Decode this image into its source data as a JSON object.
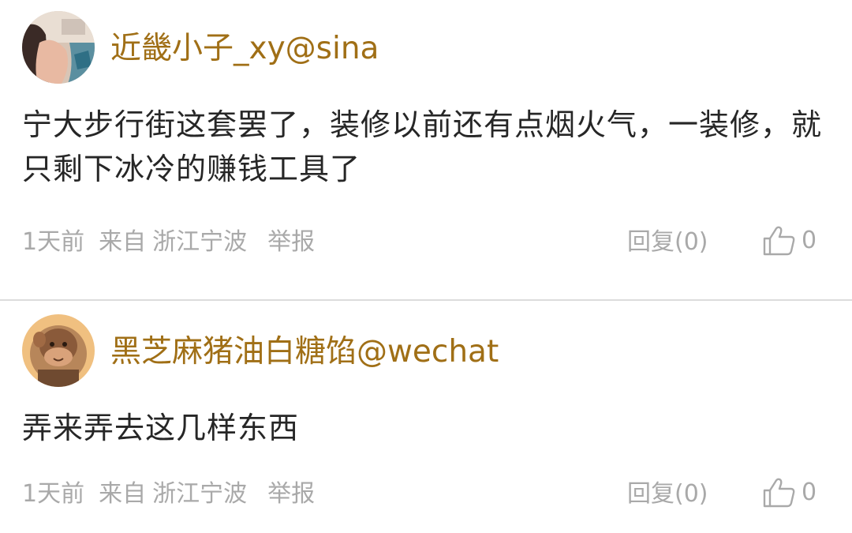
{
  "comments": [
    {
      "username": "近畿小子_xy@sina",
      "content": "宁大步行街这套罢了，装修以前还有点烟火气，一装修，就只剩下冰冷的赚钱工具了",
      "time": "1天前",
      "from_label": "来自",
      "location": "浙江宁波",
      "report_label": "举报",
      "reply_label": "回复(0)",
      "like_count": "0",
      "avatar_icon": "avatar-photo-woman-icon"
    },
    {
      "username": "黑芝麻猪油白糖馅@wechat",
      "content": "弄来弄去这几样东西",
      "time": "1天前",
      "from_label": "来自",
      "location": "浙江宁波",
      "report_label": "举报",
      "reply_label": "回复(0)",
      "like_count": "0",
      "avatar_icon": "avatar-monkey-icon"
    }
  ],
  "colors": {
    "username": "#a06f16",
    "content": "#262626",
    "meta": "#a9a9a9",
    "divider": "#dcdcdc"
  },
  "icons": {
    "like": "thumbs-up-icon"
  }
}
